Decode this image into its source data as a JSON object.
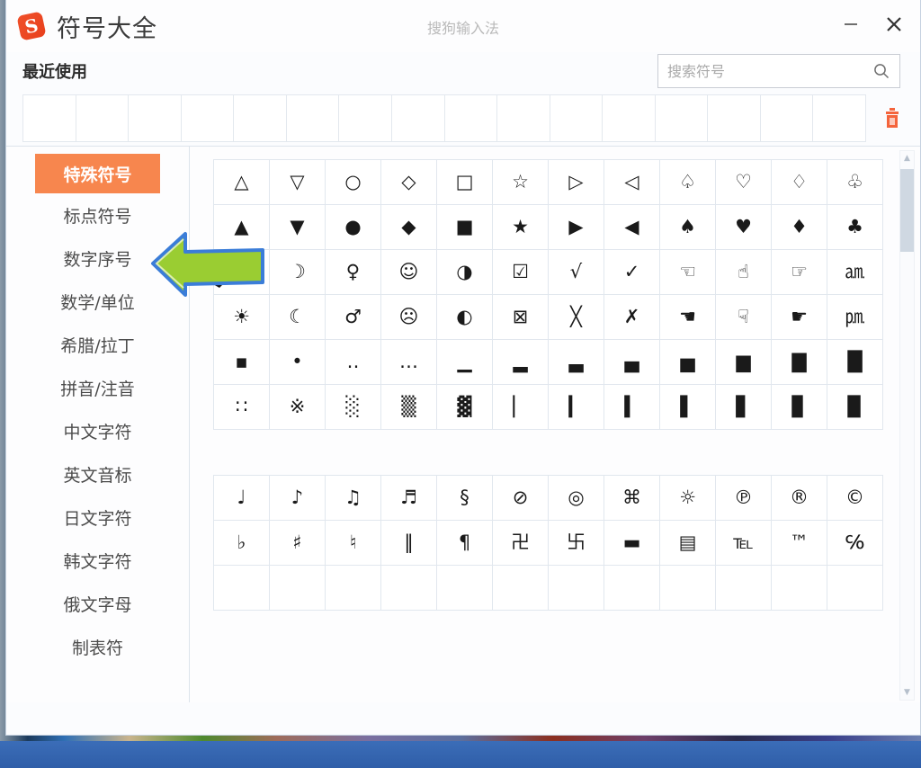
{
  "window": {
    "app_title": "符号大全",
    "window_name": "搜狗输入法",
    "logo_letter": "S",
    "minimize_label": "—",
    "close_label": "✕",
    "accent_color": "#f7864e",
    "logo_color": "#ea4a1e",
    "trash_color": "#f4643c"
  },
  "recent": {
    "label": "最近使用",
    "cell_count": 16,
    "cells": [
      "",
      "",
      "",
      "",
      "",
      "",
      "",
      "",
      "",
      "",
      "",
      "",
      "",
      "",
      "",
      ""
    ],
    "clear_icon": "trash-icon"
  },
  "search": {
    "placeholder": "搜索符号",
    "value": "",
    "icon": "search-icon"
  },
  "sidebar": {
    "selected_index": 0,
    "items": [
      {
        "label": "特殊符号"
      },
      {
        "label": "标点符号"
      },
      {
        "label": "数字序号"
      },
      {
        "label": "数学/单位"
      },
      {
        "label": "希腊/拉丁"
      },
      {
        "label": "拼音/注音"
      },
      {
        "label": "中文字符"
      },
      {
        "label": "英文音标"
      },
      {
        "label": "日文字符"
      },
      {
        "label": "韩文字符"
      },
      {
        "label": "俄文字母"
      },
      {
        "label": "制表符"
      }
    ]
  },
  "panels": [
    {
      "name": "special-symbols-panel-1",
      "columns": 12,
      "symbols": [
        "△",
        "▽",
        "○",
        "◇",
        "□",
        "☆",
        "▷",
        "◁",
        "♤",
        "♡",
        "♢",
        "♧",
        "▲",
        "▼",
        "●",
        "◆",
        "■",
        "★",
        "▶",
        "◀",
        "♠",
        "♥",
        "♦",
        "♣",
        "✿",
        "☽",
        "♀",
        "☺",
        "◑",
        "☑",
        "√",
        "✓",
        "☜",
        "☝",
        "☞",
        "㏂",
        "☀",
        "☾",
        "♂",
        "☹",
        "◐",
        "⊠",
        "╳",
        "✗",
        "☚",
        "☟",
        "☛",
        "㏘",
        "▪",
        "•",
        "‥",
        "…",
        "▁",
        "▂",
        "▃",
        "▄",
        "▅",
        "▆",
        "▇",
        "█",
        "∷",
        "※",
        "░",
        "▒",
        "▓",
        "▏",
        "▎",
        "▍",
        "▌",
        "▋",
        "▊",
        "▉"
      ]
    },
    {
      "name": "special-symbols-panel-2",
      "columns": 12,
      "symbols": [
        "♩",
        "♪",
        "♫",
        "♬",
        "§",
        "⊘",
        "◎",
        "⌘",
        "☼",
        "℗",
        "®",
        "©",
        "♭",
        "♯",
        "♮",
        "‖",
        "¶",
        "卍",
        "卐",
        "▬",
        "▤",
        "℡",
        "™",
        "℅",
        "",
        "",
        "",
        "",
        "",
        "",
        "",
        "",
        "",
        "",
        "",
        ""
      ]
    }
  ],
  "scrollbar": {
    "up_arrow": "▲",
    "down_arrow": "▼",
    "thumb_position": "top"
  },
  "annotation": {
    "arrow": "green-left-arrow",
    "points_at": "标点符号"
  }
}
